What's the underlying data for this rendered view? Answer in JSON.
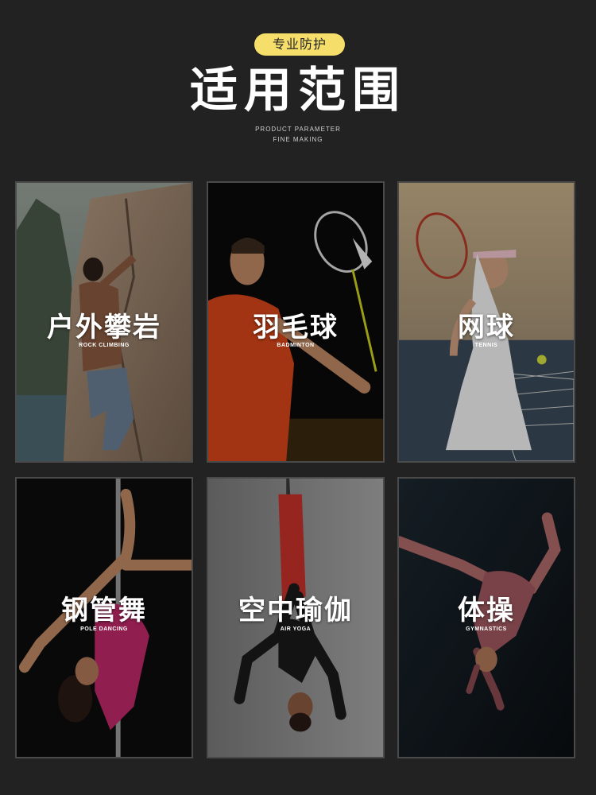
{
  "header": {
    "badge": "专业防护",
    "title": "适用范围",
    "subtitle_line1": "PRODUCT PARAMETER",
    "subtitle_line2": "FINE MAKING"
  },
  "colors": {
    "background": "#222222",
    "badge": "#f6de6a",
    "card_border": "#4a4a4a"
  },
  "cards": [
    {
      "cn": "户外攀岩",
      "en": "ROCK CLIMBING",
      "photo": "rock-climber-photo"
    },
    {
      "cn": "羽毛球",
      "en": "BADMINTON",
      "photo": "badminton-player-photo"
    },
    {
      "cn": "网球",
      "en": "TENNIS",
      "photo": "tennis-player-photo"
    },
    {
      "cn": "钢管舞",
      "en": "POLE DANCING",
      "photo": "pole-dancer-photo"
    },
    {
      "cn": "空中瑜伽",
      "en": "AIR YOGA",
      "photo": "aerial-yoga-photo"
    },
    {
      "cn": "体操",
      "en": "GYMNASTICS",
      "photo": "gymnast-photo"
    }
  ]
}
